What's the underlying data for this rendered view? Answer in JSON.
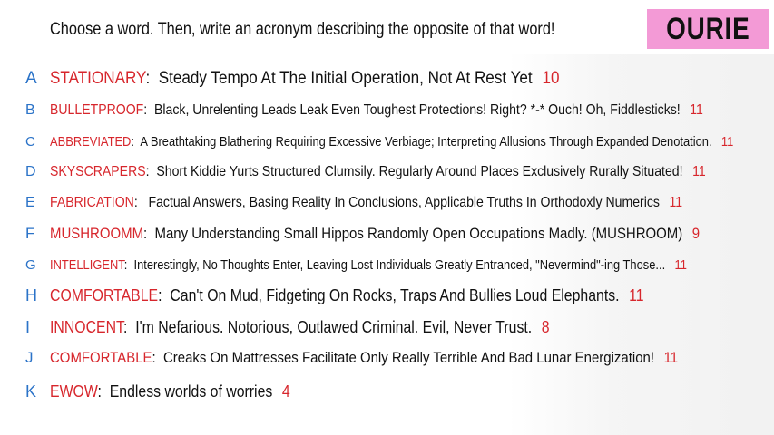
{
  "prompt": "Choose a word. Then, write an acronym describing the opposite of that word!",
  "player_name": "OURIE",
  "answers": [
    {
      "letter": "A",
      "word": "STATIONARY",
      "acronym": "Steady Tempo At The Initial Operation, Not At Rest Yet",
      "count": "10"
    },
    {
      "letter": "B",
      "word": "BULLETPROOF",
      "acronym": "Black, Unrelenting Leads Leak Even Toughest Protections! Right? *-* Ouch! Oh, Fiddlesticks!",
      "count": "11"
    },
    {
      "letter": "C",
      "word": "ABBREVIATED",
      "acronym": "A Breathtaking Blathering Requiring Excessive Verbiage; Interpreting Allusions Through Expanded Denotation.",
      "count": "11"
    },
    {
      "letter": "D",
      "word": "SKYSCRAPERS",
      "acronym": "Short Kiddie Yurts Structured Clumsily. Regularly Around Places Exclusively Rurally Situated!",
      "count": "11"
    },
    {
      "letter": "E",
      "word": "FABRICATION",
      "acronym": "Factual Answers, Basing Reality In Conclusions, Applicable Truths In Orthodoxly Numerics",
      "count": "11"
    },
    {
      "letter": "F",
      "word": "MUSHROOMM",
      "acronym": "Many Understanding Small Hippos Randomly Open Occupations Madly. (MUSHROOM)",
      "count": "9"
    },
    {
      "letter": "G",
      "word": "INTELLIGENT",
      "acronym": "Interestingly, No Thoughts Enter, Leaving Lost Individuals Greatly Entranced, \"Nevermind\"-ing Those...",
      "count": "11"
    },
    {
      "letter": "H",
      "word": "COMFORTABLE",
      "acronym": "Can't On Mud, Fidgeting On Rocks, Traps And Bullies Loud Elephants.",
      "count": "11"
    },
    {
      "letter": "I",
      "word": "INNOCENT",
      "acronym": "I'm Nefarious. Notorious, Outlawed Criminal. Evil, Never Trust.",
      "count": "8"
    },
    {
      "letter": "J",
      "word": "COMFORTABLE",
      "acronym": "Creaks On Mattresses Facilitate Only Really Terrible And Bad Lunar Energization!",
      "count": "11"
    },
    {
      "letter": "K",
      "word": "EWOW",
      "acronym": "Endless worlds of worries",
      "count": "4"
    }
  ],
  "colors": {
    "letter": "#2b73c8",
    "word": "#d7262c",
    "count": "#d7262c",
    "badge": "#f39ad6"
  }
}
